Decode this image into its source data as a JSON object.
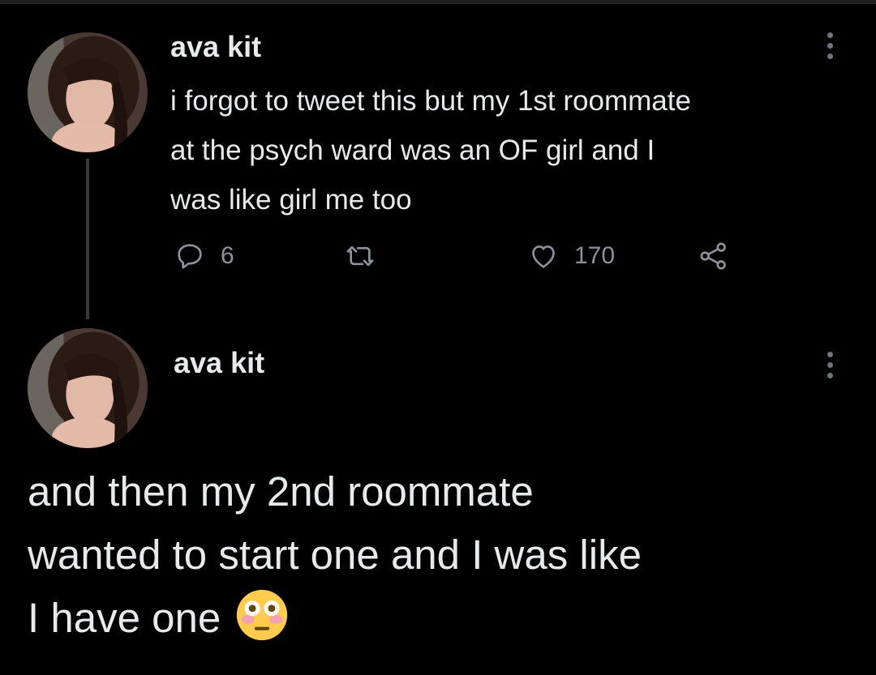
{
  "tweets": [
    {
      "author": "ava kit",
      "text_lines": [
        "i forgot to tweet this but my 1st roommate",
        "at the psych ward was an OF girl and I",
        "was like girl me too"
      ],
      "actions": {
        "reply_count": "6",
        "retweet_count": "",
        "like_count": "170"
      }
    },
    {
      "author": "ava kit",
      "text_lines": [
        "and then my 2nd roommate",
        "wanted to start one and I was like",
        "I have one"
      ],
      "emoji": "flushed-face"
    }
  ],
  "icons": {
    "reply": "reply-icon",
    "retweet": "retweet-icon",
    "like": "heart-icon",
    "share": "share-icon",
    "more": "more-options-icon"
  },
  "colors": {
    "background": "#000000",
    "text": "#e7e9ea",
    "muted": "#8b9298",
    "thread_line": "#3a3a3a"
  }
}
